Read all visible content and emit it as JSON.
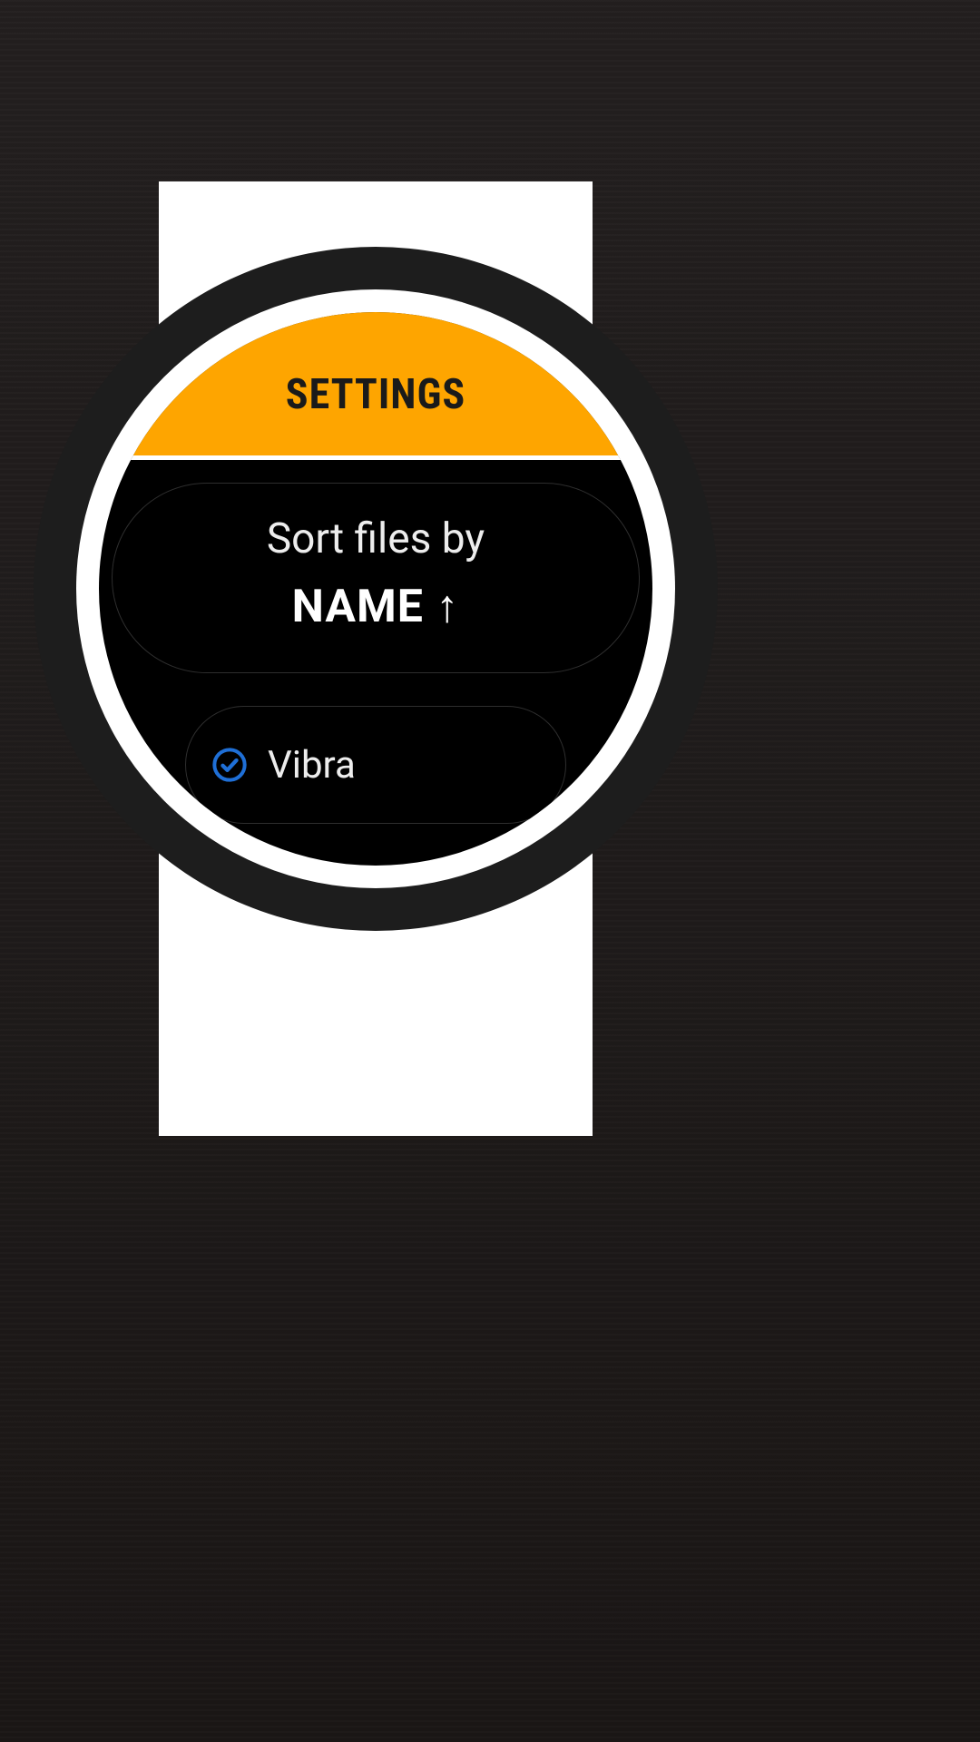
{
  "header": {
    "title": "SETTINGS"
  },
  "sort": {
    "label": "Sort files by",
    "value": "NAME ↑"
  },
  "options": [
    {
      "label": "Vibra",
      "checked": true
    }
  ],
  "colors": {
    "accent": "#fea500",
    "check": "#1f6fd6"
  }
}
